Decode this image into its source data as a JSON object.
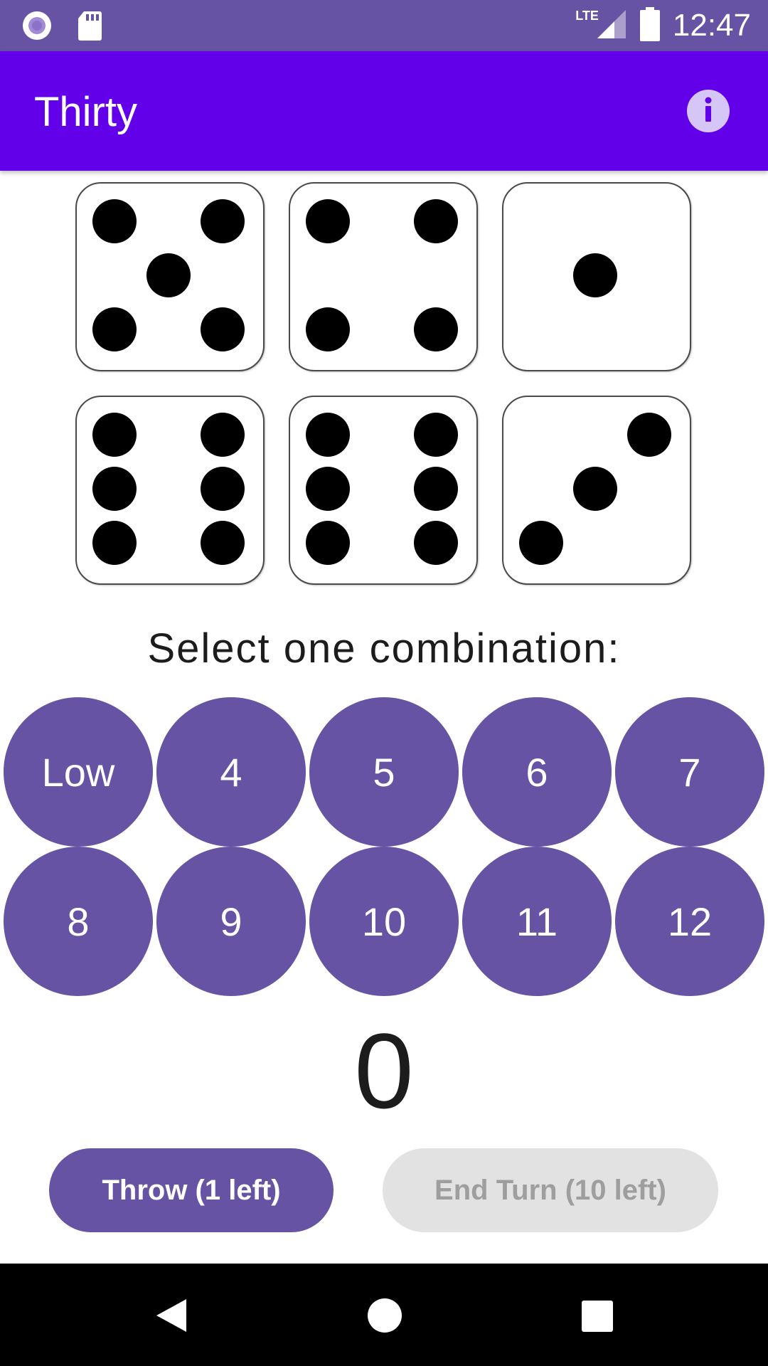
{
  "status_bar": {
    "time": "12:47",
    "network": "LTE",
    "icons": [
      "record-icon",
      "sd-card-icon",
      "signal-icon",
      "battery-icon"
    ]
  },
  "app_bar": {
    "title": "Thirty",
    "info_icon": "info-icon"
  },
  "dice": [
    5,
    4,
    1,
    6,
    6,
    3
  ],
  "prompt": "Select one combination:",
  "combinations": [
    "Low",
    "4",
    "5",
    "6",
    "7",
    "8",
    "9",
    "10",
    "11",
    "12"
  ],
  "score": "0",
  "buttons": {
    "throw": "Throw (1 left)",
    "end_turn": "End Turn (10 left)",
    "end_turn_enabled": false
  },
  "nav_bar": {
    "icons": [
      "back-icon",
      "home-icon",
      "recents-icon"
    ]
  },
  "colors": {
    "status_bar": "#6653a3",
    "app_bar": "#6200ea",
    "accent": "#6653a3",
    "disabled": "#e2e2e2"
  }
}
